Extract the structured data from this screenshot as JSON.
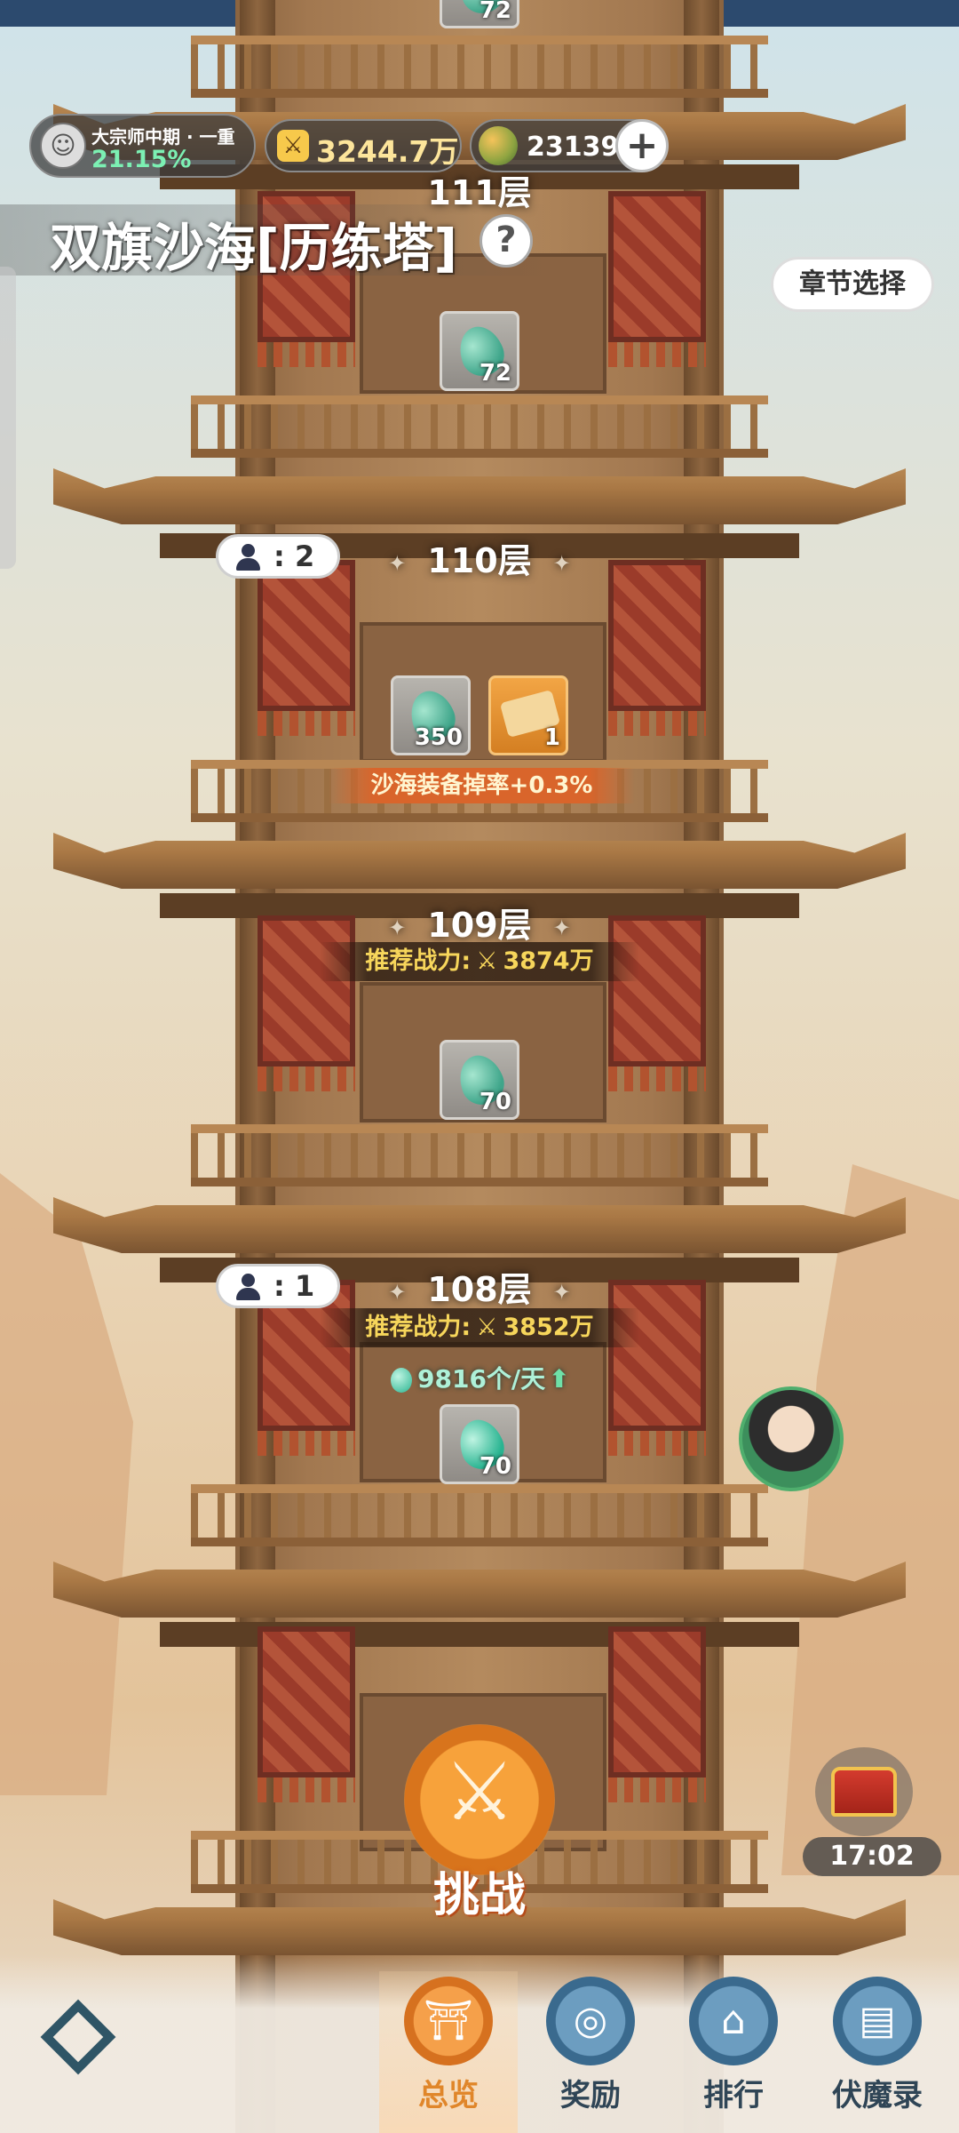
{
  "hud": {
    "player_rank": "大宗师中期 · 一重",
    "player_progress": "21.15%",
    "power": "3244.7万",
    "currency": "23139",
    "plus_label": "+"
  },
  "title": "双旗沙海[历练塔]",
  "help_label": "?",
  "chapter_select": "章节选择",
  "floors": [
    {
      "label": "111层",
      "items": [
        {
          "count": "72"
        }
      ]
    },
    {
      "label": "110层",
      "players": "2",
      "items": [
        {
          "count": "350"
        },
        {
          "count": "1"
        }
      ],
      "bonus": "沙海装备掉率+0.3%"
    },
    {
      "label": "109层",
      "recommended": "推荐战力:",
      "power": "3874万",
      "items": [
        {
          "count": "70"
        }
      ]
    },
    {
      "label": "108层",
      "players": "1",
      "recommended": "推荐战力:",
      "power": "3852万",
      "yield": "9816个/天",
      "items": [
        {
          "count": "70"
        }
      ]
    }
  ],
  "top_partial_count": "72",
  "player_count_sep": ":",
  "challenge_label": "挑战",
  "chest_timer": "17:02",
  "nav": [
    {
      "label": "总览",
      "active": true,
      "icon": "pagoda-icon"
    },
    {
      "label": "奖励",
      "active": false,
      "icon": "reward-icon"
    },
    {
      "label": "排行",
      "active": false,
      "icon": "ranking-icon"
    },
    {
      "label": "伏魔录",
      "active": false,
      "icon": "scroll-icon"
    }
  ],
  "colors": {
    "accent": "#e0862a",
    "power_text": "#f7d65b",
    "jade": "#29b491",
    "bonus_bar": "#d9652b"
  }
}
